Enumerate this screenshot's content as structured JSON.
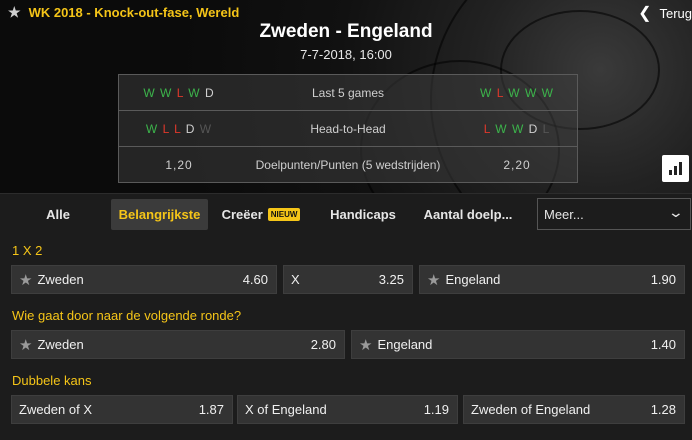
{
  "header": {
    "competition": "WK 2018 - Knock-out-fase, Wereld",
    "back_label": "Terug",
    "match_title": "Zweden - Engeland",
    "match_date": "7-7-2018, 16:00"
  },
  "stats": {
    "rows": [
      {
        "label": "Last 5 games",
        "left": [
          "W",
          "W",
          "L",
          "W",
          "D"
        ],
        "right": [
          "W",
          "L",
          "W",
          "W",
          "W"
        ],
        "left_faded": [
          false,
          false,
          false,
          false,
          false
        ],
        "right_faded": [
          false,
          false,
          false,
          false,
          false
        ]
      },
      {
        "label": "Head-to-Head",
        "left": [
          "W",
          "L",
          "L",
          "D",
          "W"
        ],
        "right": [
          "L",
          "W",
          "W",
          "D",
          "L"
        ],
        "left_faded": [
          false,
          false,
          false,
          false,
          true
        ],
        "right_faded": [
          false,
          false,
          false,
          false,
          true
        ]
      },
      {
        "label": "Doelpunten/Punten (5 wedstrijden)",
        "left_value": "1,20",
        "right_value": "2,20"
      }
    ]
  },
  "tabs": {
    "items": [
      {
        "label": "Alle"
      },
      {
        "label": "Belangrijkste",
        "active": true
      },
      {
        "label": "Creëer",
        "badge": "NIEUW"
      },
      {
        "label": "Handicaps"
      },
      {
        "label": "Aantal doelp..."
      }
    ],
    "more_select": "Meer..."
  },
  "markets": [
    {
      "title": "1 X 2",
      "odds": [
        {
          "name": "Zweden",
          "price": "4.60",
          "star": true
        },
        {
          "name": "X",
          "price": "3.25",
          "star": false
        },
        {
          "name": "Engeland",
          "price": "1.90",
          "star": true
        }
      ]
    },
    {
      "title": "Wie gaat door naar de volgende ronde?",
      "odds": [
        {
          "name": "Zweden",
          "price": "2.80",
          "star": true
        },
        {
          "name": "Engeland",
          "price": "1.40",
          "star": true
        }
      ]
    },
    {
      "title": "Dubbele kans",
      "odds": [
        {
          "name": "Zweden of X",
          "price": "1.87",
          "star": false
        },
        {
          "name": "X of Engeland",
          "price": "1.19",
          "star": false
        },
        {
          "name": "Zweden of Engeland",
          "price": "1.28",
          "star": false
        }
      ]
    }
  ],
  "colors": {
    "accent": "#f5c518",
    "win": "#3cb44b",
    "loss": "#e0382b",
    "draw": "#cfcfcf"
  },
  "icons": {
    "favorite": "star-icon",
    "back": "chevron-left-icon",
    "stats": "bar-chart-icon",
    "dropdown": "chevron-down-icon"
  }
}
